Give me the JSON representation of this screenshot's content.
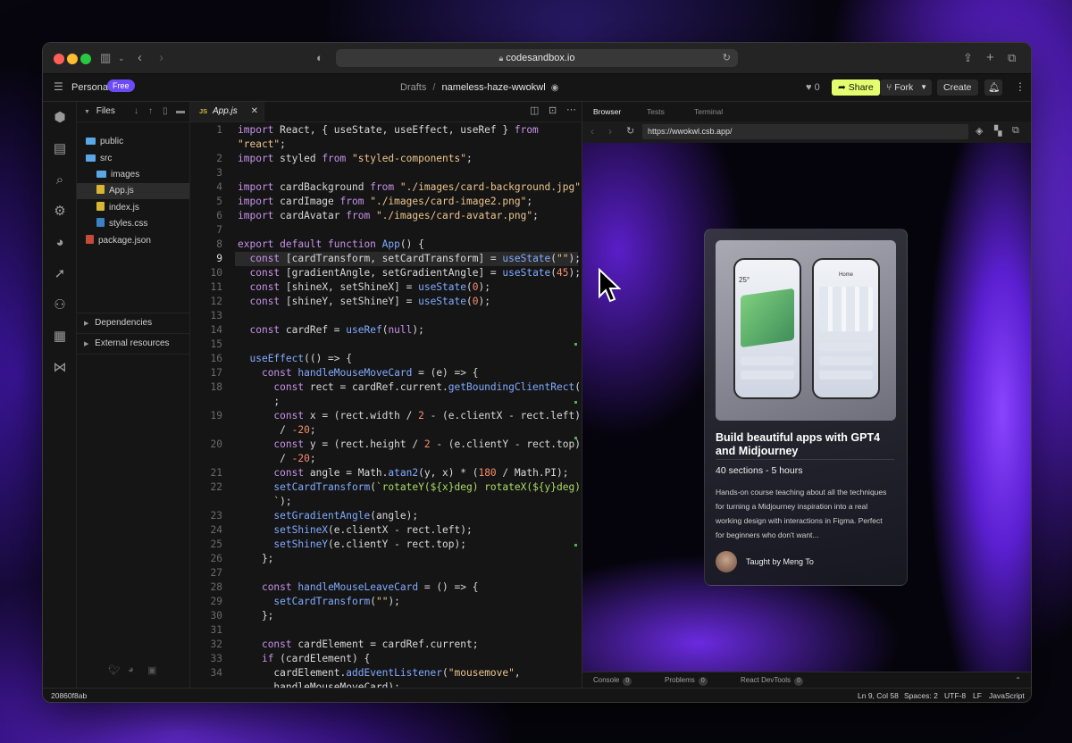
{
  "safari": {
    "url": "codesandbox.io"
  },
  "header": {
    "workspace": "Personal",
    "plan_badge": "Free",
    "breadcrumb_root": "Drafts",
    "breadcrumb_sep": "/",
    "sandbox_name": "nameless-haze-wwokwl",
    "likes": "0",
    "share_label": "Share",
    "fork_label": "Fork",
    "create_label": "Create"
  },
  "explorer": {
    "title": "Files",
    "items": [
      {
        "name": "public",
        "type": "folder",
        "depth": 0
      },
      {
        "name": "src",
        "type": "folder",
        "depth": 0
      },
      {
        "name": "images",
        "type": "folder",
        "depth": 1
      },
      {
        "name": "App.js",
        "type": "js",
        "depth": 1,
        "selected": true
      },
      {
        "name": "index.js",
        "type": "js",
        "depth": 1
      },
      {
        "name": "styles.css",
        "type": "css",
        "depth": 1
      },
      {
        "name": "package.json",
        "type": "json",
        "depth": 0
      }
    ],
    "dependencies_label": "Dependencies",
    "external_label": "External resources"
  },
  "editor": {
    "tab_prefix": "JS",
    "tab_name": "App.js",
    "current_line": 9,
    "lines": [
      {
        "n": "1",
        "html": "<span class=\"kw\">import</span> React, { useState, useEffect, useRef } <span class=\"kw\">from</span>"
      },
      {
        "n": "",
        "html": "<span class=\"str\">\"react\"</span>;"
      },
      {
        "n": "2",
        "html": "<span class=\"kw\">import</span> styled <span class=\"kw\">from</span> <span class=\"str\">\"styled-components\"</span>;"
      },
      {
        "n": "3",
        "html": ""
      },
      {
        "n": "4",
        "html": "<span class=\"kw\">import</span> cardBackground <span class=\"kw\">from</span> <span class=\"str\">\"./images/card-background.jpg\"</span>;"
      },
      {
        "n": "5",
        "html": "<span class=\"kw\">import</span> cardImage <span class=\"kw\">from</span> <span class=\"str\">\"./images/card-image2.png\"</span>;"
      },
      {
        "n": "6",
        "html": "<span class=\"kw\">import</span> cardAvatar <span class=\"kw\">from</span> <span class=\"str\">\"./images/card-avatar.png\"</span>;"
      },
      {
        "n": "7",
        "html": ""
      },
      {
        "n": "8",
        "html": "<span class=\"kw\">export default function</span> <span class=\"fn\">App</span>() {"
      },
      {
        "n": "9",
        "html": "  <span class=\"kw\">const</span> [cardTransform, setCardTransform] = <span class=\"fn\">useState</span>(<span class=\"str\">\"\"</span>);"
      },
      {
        "n": "10",
        "html": "  <span class=\"kw\">const</span> [gradientAngle, setGradientAngle] = <span class=\"fn\">useState</span>(<span class=\"num\">45</span>);"
      },
      {
        "n": "11",
        "html": "  <span class=\"kw\">const</span> [shineX, setShineX] = <span class=\"fn\">useState</span>(<span class=\"num\">0</span>);"
      },
      {
        "n": "12",
        "html": "  <span class=\"kw\">const</span> [shineY, setShineY] = <span class=\"fn\">useState</span>(<span class=\"num\">0</span>);"
      },
      {
        "n": "13",
        "html": ""
      },
      {
        "n": "14",
        "html": "  <span class=\"kw\">const</span> cardRef = <span class=\"fn\">useRef</span>(<span class=\"kw\">null</span>);"
      },
      {
        "n": "15",
        "html": ""
      },
      {
        "n": "16",
        "html": "  <span class=\"fn\">useEffect</span>(() => {"
      },
      {
        "n": "17",
        "html": "    <span class=\"kw\">const</span> <span class=\"fn\">handleMouseMoveCard</span> = (e) => {"
      },
      {
        "n": "18",
        "html": "      <span class=\"kw\">const</span> rect = cardRef.current.<span class=\"fn\">getBoundingClientRect</span>()"
      },
      {
        "n": "",
        "html": "      ;"
      },
      {
        "n": "19",
        "html": "      <span class=\"kw\">const</span> x = (rect.width / <span class=\"num\">2</span> - (e.clientX - rect.left))"
      },
      {
        "n": "",
        "html": "       / <span class=\"num\">-20</span>;"
      },
      {
        "n": "20",
        "html": "      <span class=\"kw\">const</span> y = (rect.height / <span class=\"num\">2</span> - (e.clientY - rect.top))"
      },
      {
        "n": "",
        "html": "       / <span class=\"num\">-20</span>;"
      },
      {
        "n": "21",
        "html": "      <span class=\"kw\">const</span> angle = Math.<span class=\"fn\">atan2</span>(y, x) * (<span class=\"num\">180</span> / Math.PI);"
      },
      {
        "n": "22",
        "html": "      <span class=\"fn\">setCardTransform</span>(<span class=\"tag\">`rotateY(${x}deg) rotateX(${y}deg)</span>"
      },
      {
        "n": "",
        "html": "      <span class=\"tag\">`</span>);"
      },
      {
        "n": "23",
        "html": "      <span class=\"fn\">setGradientAngle</span>(angle);"
      },
      {
        "n": "24",
        "html": "      <span class=\"fn\">setShineX</span>(e.clientX - rect.left);"
      },
      {
        "n": "25",
        "html": "      <span class=\"fn\">setShineY</span>(e.clientY - rect.top);"
      },
      {
        "n": "26",
        "html": "    };"
      },
      {
        "n": "27",
        "html": ""
      },
      {
        "n": "28",
        "html": "    <span class=\"kw\">const</span> <span class=\"fn\">handleMouseLeaveCard</span> = () => {"
      },
      {
        "n": "29",
        "html": "      <span class=\"fn\">setCardTransform</span>(<span class=\"str\">\"\"</span>);"
      },
      {
        "n": "30",
        "html": "    };"
      },
      {
        "n": "31",
        "html": ""
      },
      {
        "n": "32",
        "html": "    <span class=\"kw\">const</span> cardElement = cardRef.current;"
      },
      {
        "n": "33",
        "html": "    <span class=\"kw\">if</span> (cardElement) {"
      },
      {
        "n": "34",
        "html": "      cardElement.<span class=\"fn\">addEventListener</span>(<span class=\"str\">\"mousemove\"</span>,"
      },
      {
        "n": "",
        "html": "      handleMouseMoveCard);"
      }
    ]
  },
  "preview": {
    "tabs": [
      "Browser",
      "Tests",
      "Terminal"
    ],
    "address": "https://wwokwl.csb.app/",
    "bottom_tabs": [
      {
        "label": "Console",
        "count": "0"
      },
      {
        "label": "Problems",
        "count": "0"
      },
      {
        "label": "React DevTools",
        "count": "0"
      }
    ],
    "card": {
      "title": "Build beautiful apps with GPT4 and Midjourney",
      "meta": "40 sections - 5 hours",
      "description": "Hands-on course teaching about all the techniques for turning a Midjourney inspiration into a real working design with interactions in Figma. Perfect for beginners who don't want...",
      "author": "Taught by Meng To",
      "phone_temp": "25°",
      "phone_home": "Home"
    }
  },
  "status": {
    "commit": "20860f8ab",
    "position": "Ln 9, Col 58",
    "spaces": "Spaces: 2",
    "encoding": "UTF-8",
    "eol": "LF",
    "language": "JavaScript"
  },
  "colors": {
    "share_bg": "#e4ff6e",
    "free_badge": "#6c4bf5"
  }
}
